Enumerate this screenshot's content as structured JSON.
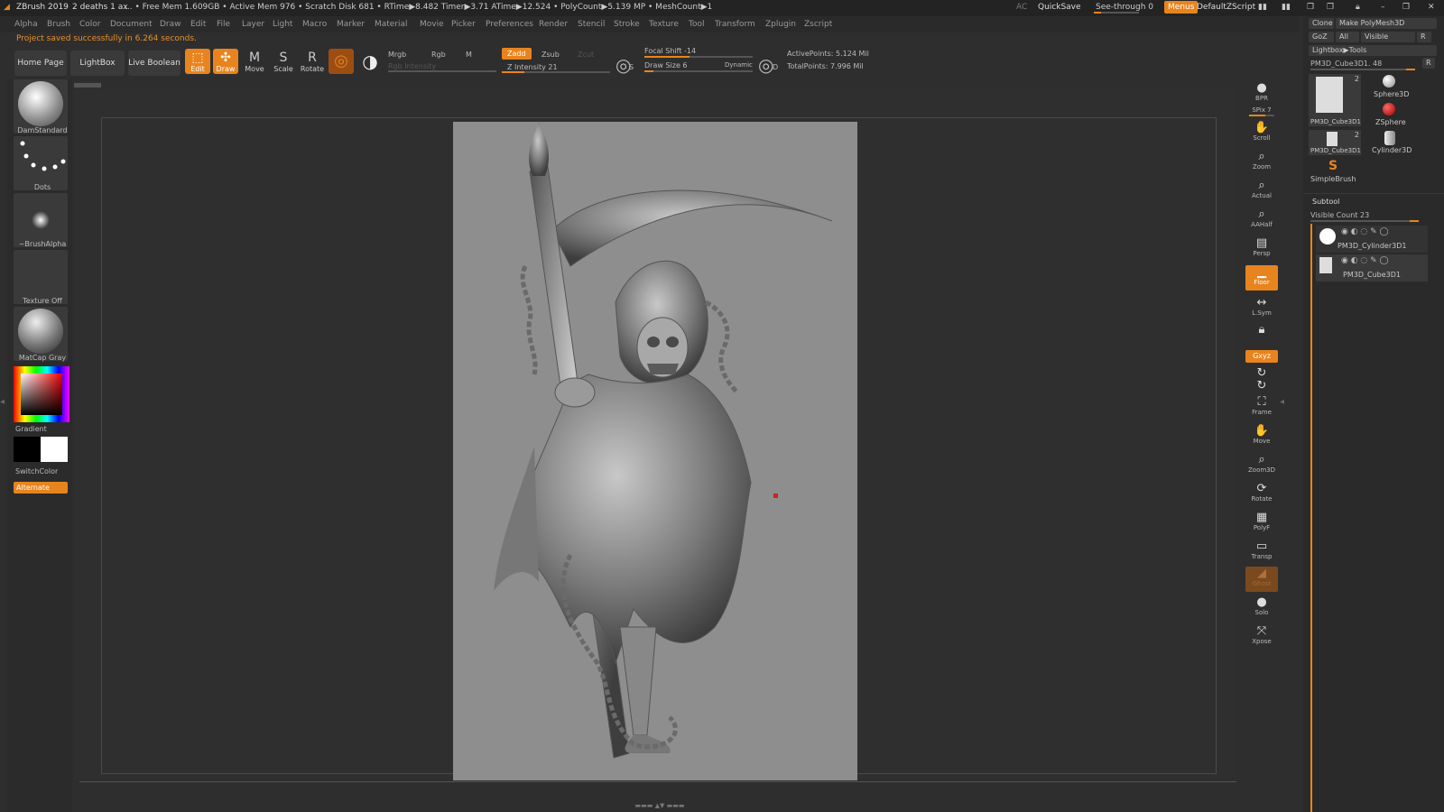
{
  "titlebar": {
    "app": "ZBrush 2019",
    "doc": "2 deaths 1 ax",
    "stats": "... • Free Mem 1.609GB • Active Mem 976 • Scratch Disk 681 • RTime▶8.482 Timer▶3.71 ATime▶12.524 • PolyCount▶5.139 MP • MeshCount▶1",
    "ac": "AC",
    "quicksave": "QuickSave",
    "see_through": "See-through  0",
    "menus": "Menus",
    "default_zscript": "DefaultZScript"
  },
  "menubar": [
    "Alpha",
    "Brush",
    "Color",
    "Document",
    "Draw",
    "Edit",
    "File",
    "Layer",
    "Light",
    "Macro",
    "Marker",
    "Material",
    "Movie",
    "Picker",
    "Preferences",
    "Render",
    "Stencil",
    "Stroke",
    "Texture",
    "Tool",
    "Transform",
    "Zplugin",
    "Zscript"
  ],
  "notice": "Project saved successfully in 6.264 seconds.",
  "toolbar": {
    "home_page": "Home Page",
    "lightbox": "LightBox",
    "live_boolean": "Live Boolean",
    "edit": "Edit",
    "draw": "Draw",
    "move": "Move",
    "scale": "Scale",
    "rotate": "Rotate",
    "mrgb": "Mrgb",
    "rgb": "Rgb",
    "m": "M",
    "rgb_intensity": "Rgb Intensity",
    "zadd": "Zadd",
    "zsub": "Zsub",
    "zcut": "Zcut",
    "z_intensity": "Z Intensity 21",
    "z_intensity_value": 21,
    "focal_shift": "Focal Shift -14",
    "draw_size": "Draw Size 6",
    "dynamic": "Dynamic",
    "active_points": "ActivePoints: 5.124 Mil",
    "total_points": "TotalPoints: 7.996 Mil"
  },
  "leftshelf": {
    "brush": "DamStandard",
    "stroke": "Dots",
    "alpha": "~BrushAlpha",
    "texture": "Texture Off",
    "material": "MatCap Gray",
    "gradient": "Gradient",
    "switchcolor": "SwitchColor",
    "alternate": "Alternate"
  },
  "rightshelf": {
    "bpr": "BPR",
    "spix": "SPix 7",
    "scroll": "Scroll",
    "zoom": "Zoom",
    "actual": "Actual",
    "aahalf": "AAHalf",
    "persp": "Persp",
    "floor": "Floor",
    "lsym": "L.Sym",
    "xyz": "Gxyz",
    "frame": "Frame",
    "move": "Move",
    "zoom3d": "Zoom3D",
    "rotate": "Rotate",
    "polyf": "PolyF",
    "transp": "Transp",
    "ghost": "Ghost",
    "solo": "Solo",
    "xpose": "Xpose"
  },
  "toolpanel": {
    "clone": "Clone",
    "make_polymesh": "Make PolyMesh3D",
    "goz": "GoZ",
    "all": "All",
    "visible": "Visible",
    "r": "R",
    "lightbox_tools": "Lightbox▶Tools",
    "current_tool": "PM3D_Cube3D1. 48",
    "tools": [
      {
        "name": "PM3D_Cube3D1",
        "count": "2"
      },
      {
        "name": "Sphere3D",
        "count": ""
      },
      {
        "name": "PM3D_Cube3D1",
        "count": "2"
      },
      {
        "name": "ZSphere",
        "count": ""
      },
      {
        "name": "Cylinder3D",
        "count": ""
      },
      {
        "name": "SimpleBrush",
        "count": ""
      }
    ],
    "subtool_title": "Subtool",
    "visible_count": "Visible Count 23",
    "subtools": [
      "PM3D_Cylinder3D1",
      "PM3D_Cube3D1"
    ]
  },
  "colors": {
    "accent": "#e8841e",
    "panel": "#2a2a2a",
    "document": "#8e8e8e"
  }
}
